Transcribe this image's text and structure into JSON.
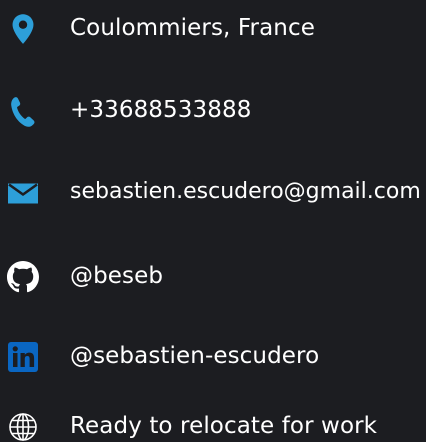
{
  "colors": {
    "background": "#1c1d21",
    "text": "#ffffff",
    "accent_blue": "#2d9fd9",
    "linkedin_blue": "#0a66c2"
  },
  "contacts": [
    {
      "icon": "location-pin-icon",
      "text": "Coulommiers, France"
    },
    {
      "icon": "phone-icon",
      "text": "+33688533888"
    },
    {
      "icon": "envelope-icon",
      "text": "sebastien.escudero@gmail.com"
    },
    {
      "icon": "github-icon",
      "text": "@beseb"
    },
    {
      "icon": "linkedin-icon",
      "text": "@sebastien-escudero"
    },
    {
      "icon": "globe-icon",
      "text": "Ready to relocate for work"
    }
  ]
}
